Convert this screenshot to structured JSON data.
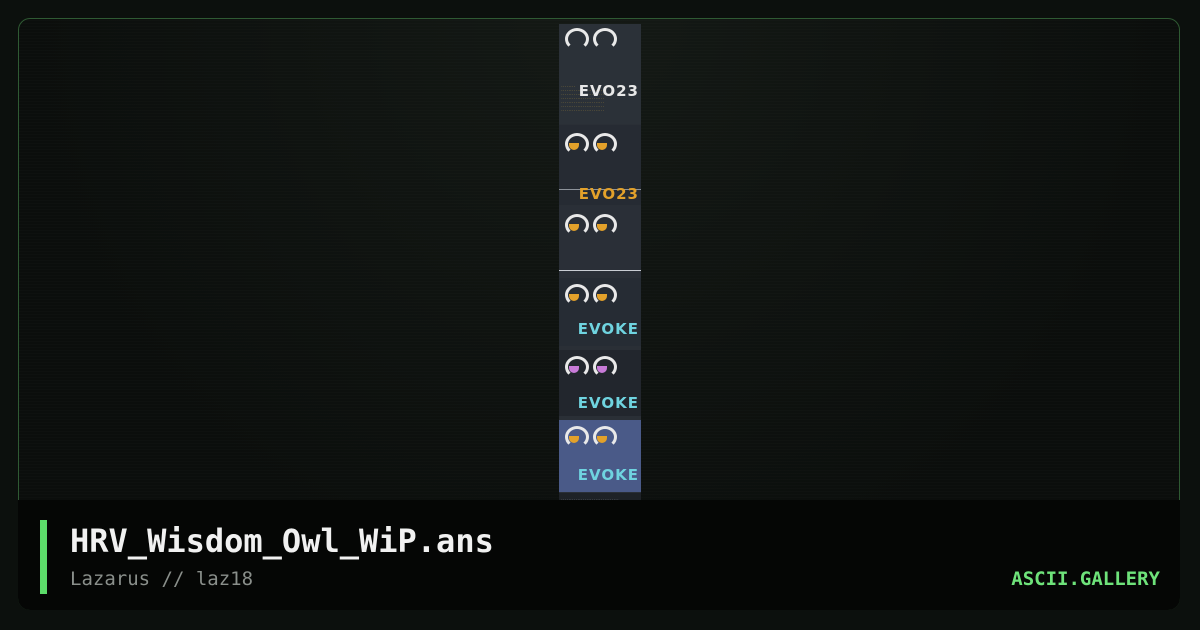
{
  "artwork": {
    "filename": "HRV_Wisdom_Owl_WiP.ans",
    "credit": "Lazarus // laz18",
    "site": "ASCII.GALLERY"
  },
  "preview": {
    "frame_labels": [
      "EVO23",
      "EVO23",
      "EVOKE",
      "EVOKE",
      "EVOKE"
    ],
    "colors": {
      "accent": "#5cdc6a",
      "border": "#2f5a33",
      "eye_gold": "#e3a12a",
      "logo_cyan": "#6fd4e0"
    }
  }
}
